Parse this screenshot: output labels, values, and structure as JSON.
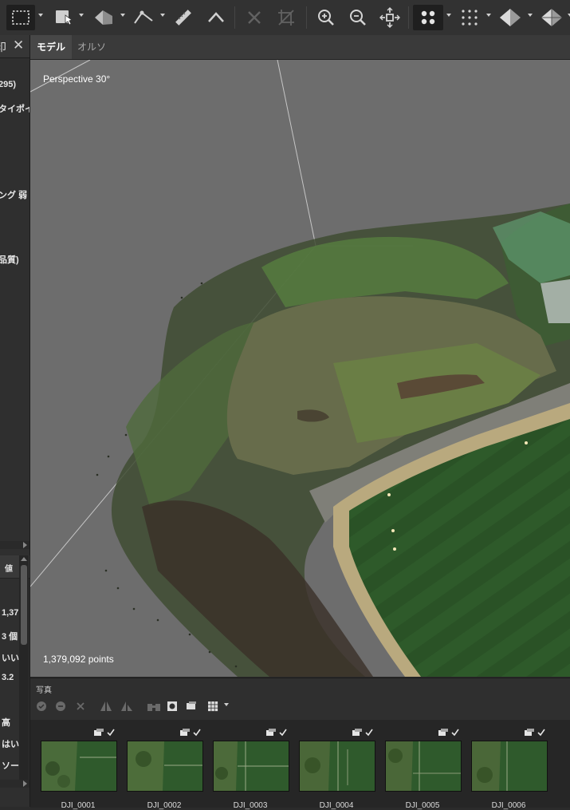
{
  "left_panel": {
    "title_fragment": "印",
    "close_glyph": "✕",
    "lines": [
      "295)",
      "タイポイ",
      "ング 弱",
      "品質)"
    ],
    "property_header": "値",
    "values": [
      "1,37",
      "3 個",
      "いい",
      "3.2",
      "高",
      "はい",
      "ソー"
    ]
  },
  "viewport": {
    "tabs": [
      {
        "label": "モデル",
        "active": true
      },
      {
        "label": "オルソ",
        "active": false
      }
    ],
    "projection": "Perspective 30°",
    "point_count": "1,379,092 points"
  },
  "photos": {
    "title": "写真",
    "thumbnails": [
      {
        "label": "DJI_0001"
      },
      {
        "label": "DJI_0002"
      },
      {
        "label": "DJI_0003"
      },
      {
        "label": "DJI_0004"
      },
      {
        "label": "DJI_0005"
      },
      {
        "label": "DJI_0006"
      }
    ]
  },
  "colors": {
    "viewport_bg": "#6d6d6d",
    "panel_bg": "#2f2f2f",
    "toolbar_bg": "#323232",
    "field_green": "#2f5a2c"
  },
  "icons": [
    "rectangle-select-icon",
    "cursor-icon",
    "shape-icon",
    "polyline-icon",
    "ruler-icon",
    "caret-up-icon",
    "delete-icon",
    "crop-icon",
    "zoom-in-icon",
    "zoom-out-icon",
    "fit-view-icon",
    "point-cloud-icon",
    "dots-grid-icon",
    "model-icon",
    "model-wire-icon"
  ]
}
